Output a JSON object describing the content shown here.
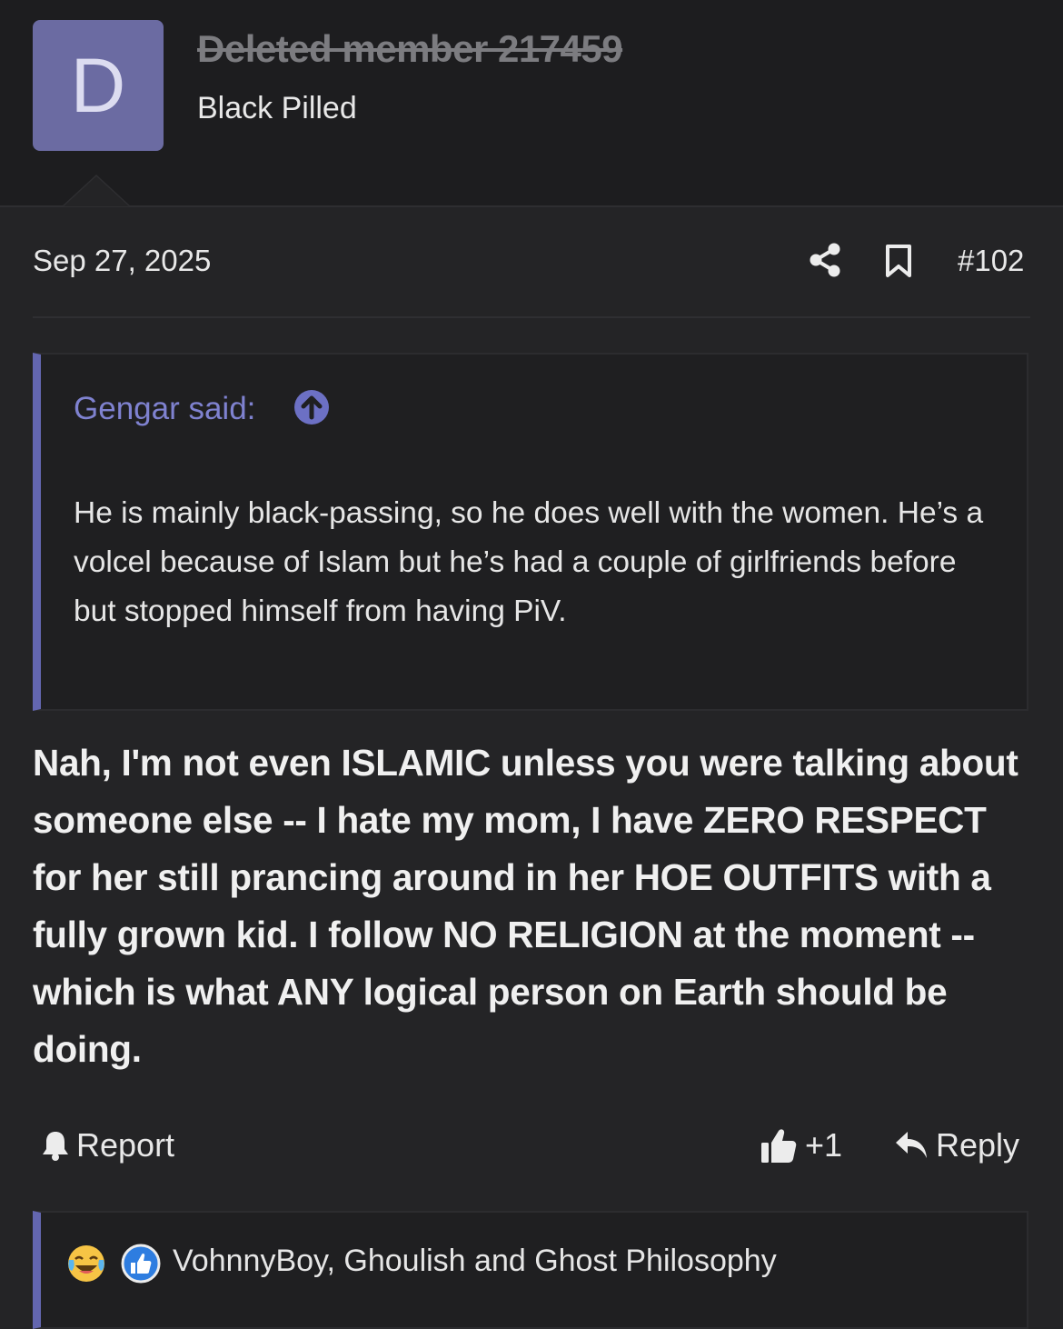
{
  "user": {
    "avatar_letter": "D",
    "name": "Deleted member 217459",
    "title": "Black Pilled"
  },
  "post": {
    "date": "Sep 27, 2025",
    "number": "#102",
    "quote": {
      "author": "Gengar said:",
      "text": "He is mainly black-passing, so he does well with the women. He’s a volcel because of Islam but he’s had a couple of girlfriends before but stopped himself from having PiV."
    },
    "body": "Nah, I'm not even ISLAMIC unless you were talking about someone else -- I hate my mom, I have ZERO RESPECT for her still prancing around in her HOE OUTFITS with a fully grown kid. I follow NO RELIGION at the moment -- which is what ANY logical person on Earth should be doing."
  },
  "actions": {
    "report_label": "Report",
    "like_count": "+1",
    "reply_label": "Reply"
  },
  "reactions": {
    "emojis": [
      "crying-laughing-emoji",
      "like-reaction-icon"
    ],
    "users_text": "VohnnyBoy, Ghoulish and Ghost Philosophy"
  },
  "colors": {
    "accent": "#6366b0",
    "avatar_bg": "#6b6ba2",
    "link": "#7f82d0",
    "background": "#242426",
    "header_bg": "#1d1d1f"
  }
}
